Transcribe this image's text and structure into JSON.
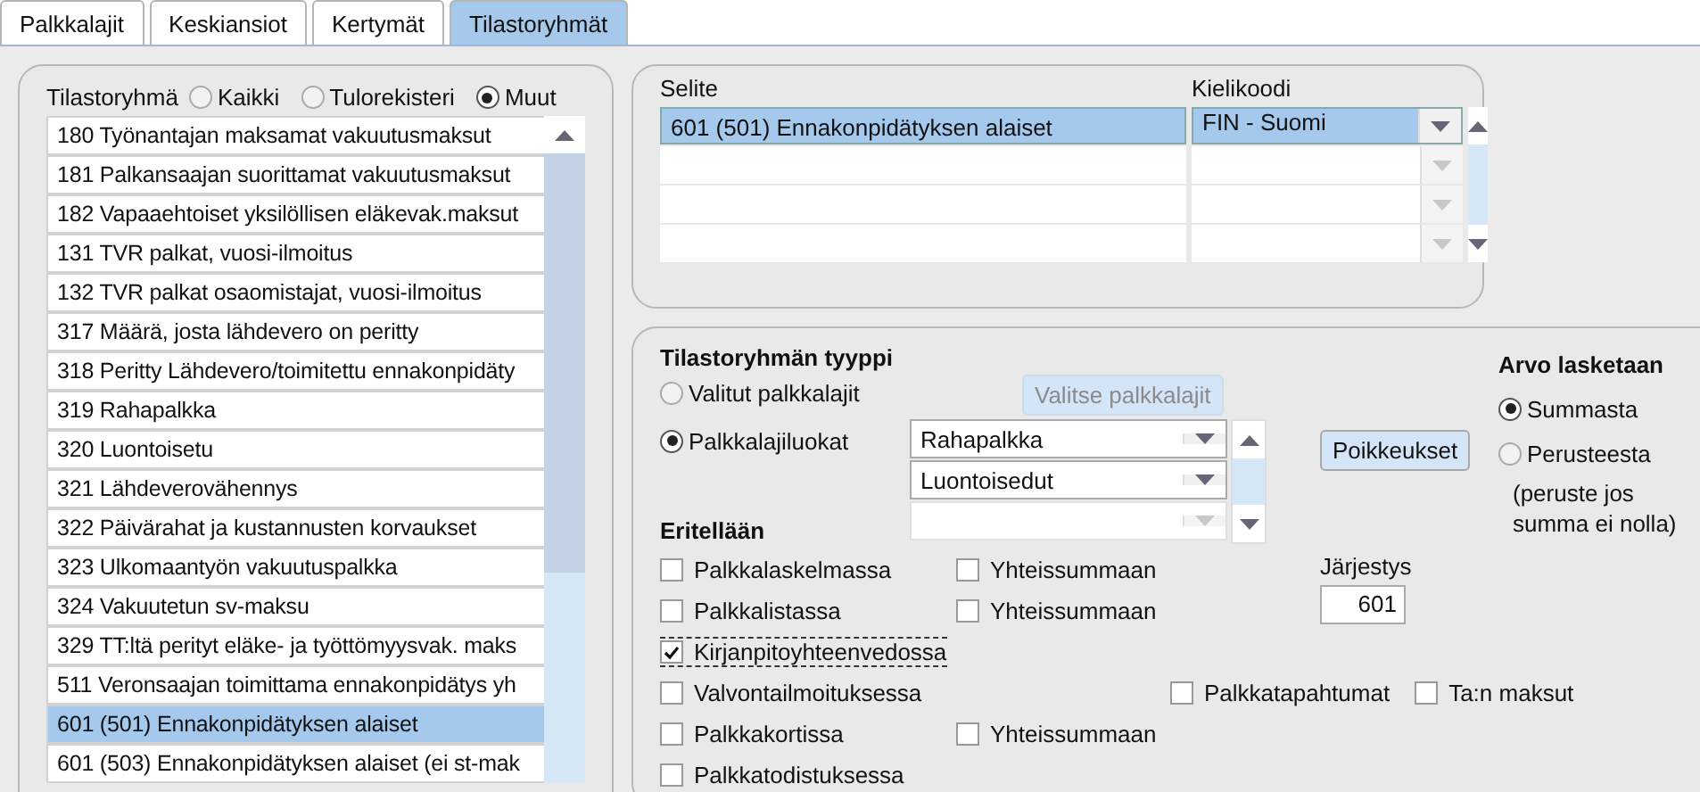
{
  "tabs": [
    {
      "label": "Palkkalajit",
      "selected": false
    },
    {
      "label": "Keskiansiot",
      "selected": false
    },
    {
      "label": "Kertymät",
      "selected": false
    },
    {
      "label": "Tilastoryhmät",
      "selected": true
    }
  ],
  "groups": {
    "label": "Tilastoryhmä",
    "filters": [
      {
        "label": "Kaikki",
        "selected": false
      },
      {
        "label": "Tulorekisteri",
        "selected": false
      },
      {
        "label": "Muut",
        "selected": true
      }
    ],
    "items": [
      {
        "label": "180 Työnantajan maksamat vakuutusmaksut",
        "selected": false
      },
      {
        "label": "181 Palkansaajan suorittamat vakuutusmaksut",
        "selected": false
      },
      {
        "label": "182 Vapaaehtoiset yksilöllisen eläkevak.maksut",
        "selected": false
      },
      {
        "label": "131 TVR palkat, vuosi-ilmoitus",
        "selected": false
      },
      {
        "label": "132 TVR palkat osaomistajat, vuosi-ilmoitus",
        "selected": false
      },
      {
        "label": "317 Määrä, josta lähdevero on peritty",
        "selected": false
      },
      {
        "label": "318 Peritty Lähdevero/toimitettu ennakonpidäty",
        "selected": false
      },
      {
        "label": "319 Rahapalkka",
        "selected": false
      },
      {
        "label": "320 Luontoisetu",
        "selected": false
      },
      {
        "label": "321 Lähdeverovähennys",
        "selected": false
      },
      {
        "label": "322 Päivärahat ja kustannusten korvaukset",
        "selected": false
      },
      {
        "label": "323 Ulkomaantyön vakuutuspalkka",
        "selected": false
      },
      {
        "label": "324 Vakuutetun sv-maksu",
        "selected": false
      },
      {
        "label": "329 TT:ltä perityt eläke- ja työttömyysvak. maks",
        "selected": false
      },
      {
        "label": "511 Veronsaajan toimittama ennakonpidätys yh",
        "selected": false
      },
      {
        "label": "601 (501) Ennakonpidätyksen alaiset",
        "selected": true
      },
      {
        "label": "601 (503) Ennakonpidätyksen alaiset (ei st-mak",
        "selected": false
      }
    ]
  },
  "descriptions": {
    "columns": [
      "Selite",
      "Kielikoodi"
    ],
    "rows": [
      {
        "selite": "601 (501) Ennakonpidätyksen alaiset",
        "kielikoodi": "FIN - Suomi",
        "selected": true
      }
    ]
  },
  "type_panel": {
    "title": "Tilastoryhmän tyyppi",
    "options": [
      {
        "label": "Valitut palkkalajit",
        "selected": false
      },
      {
        "label": "Palkkalajiluokat",
        "selected": true
      }
    ],
    "select_button": {
      "label": "Valitse palkkalajit",
      "disabled": true
    },
    "classes": [
      "Rahapalkka",
      "Luontoisedut"
    ],
    "exceptions_button": "Poikkeukset",
    "value_calc": {
      "title": "Arvo lasketaan",
      "options": [
        {
          "label": "Summasta",
          "selected": true
        },
        {
          "label": "Perusteesta",
          "selected": false
        }
      ],
      "note": "(peruste jos summa ei nolla)"
    },
    "order": {
      "label": "Järjestys",
      "value": "601"
    },
    "breakdown": {
      "title": "Eritellään",
      "rows": [
        {
          "label": "Palkkalaskelmassa",
          "checked": false,
          "focused": false,
          "extras": [
            {
              "kind": "total",
              "label": "Yhteissummaan",
              "checked": false
            }
          ]
        },
        {
          "label": "Palkkalistassa",
          "checked": false,
          "focused": false,
          "extras": [
            {
              "kind": "total",
              "label": "Yhteissummaan",
              "checked": false
            }
          ]
        },
        {
          "label": "Kirjanpitoyhteenvedossa",
          "checked": true,
          "focused": true,
          "extras": []
        },
        {
          "label": "Valvontailmoituksessa",
          "checked": false,
          "focused": false,
          "extras": [
            {
              "kind": "flag",
              "label": "Palkkatapahtumat",
              "checked": false
            },
            {
              "kind": "flag",
              "label": "Ta:n maksut",
              "checked": false
            }
          ]
        },
        {
          "label": "Palkkakortissa",
          "checked": false,
          "focused": false,
          "extras": [
            {
              "kind": "total",
              "label": "Yhteissummaan",
              "checked": false
            }
          ]
        },
        {
          "label": "Palkkatodistuksessa",
          "checked": false,
          "focused": false,
          "extras": []
        }
      ]
    }
  }
}
